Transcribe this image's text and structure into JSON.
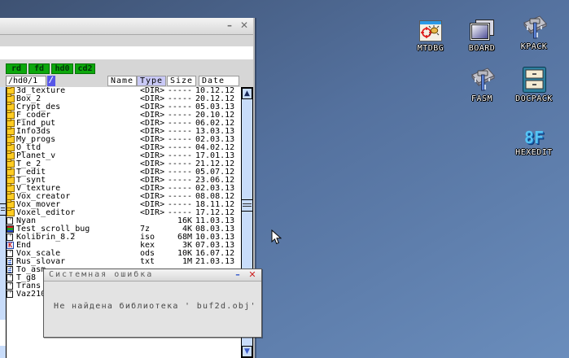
{
  "desktop": {
    "background_top": "#3e5273",
    "background_bottom": "#6a8dbc",
    "icons": [
      {
        "name": "mtdbg",
        "label": "MTDBG"
      },
      {
        "name": "board",
        "label": "BOARD"
      },
      {
        "name": "kpack",
        "label": "KPACK"
      },
      {
        "name": "fasm",
        "label": "FASM"
      },
      {
        "name": "docpack",
        "label": "DOCPACK"
      },
      {
        "name": "hexedit",
        "label": "HEXEDIT",
        "glyph": "8F"
      }
    ]
  },
  "file_manager": {
    "window_buttons": {
      "minimize": "–",
      "close": "✕"
    },
    "drive_buttons": [
      {
        "label": "rd"
      },
      {
        "label": "fd"
      },
      {
        "label": "hd0"
      },
      {
        "label": "cd2"
      }
    ],
    "path": "/hd0/1",
    "slash_button": "/",
    "columns": [
      {
        "label": "Name",
        "sorted": false
      },
      {
        "label": "Type",
        "sorted": true
      },
      {
        "label": "Size",
        "sorted": false
      },
      {
        "label": "Date",
        "sorted": false
      }
    ],
    "sort_highlight_color": "#c9c9f6",
    "drive_button_color": "#0ca80c",
    "scrollbar": {
      "up": "▲",
      "down": "▼"
    },
    "rows": [
      {
        "name": "3d_texture",
        "type": "<DIR>",
        "size": "-----",
        "date": "10.12.12",
        "icon": "folder"
      },
      {
        "name": "Box_2",
        "type": "<DIR>",
        "size": "-----",
        "date": "20.12.12",
        "icon": "folder"
      },
      {
        "name": "Crypt_des",
        "type": "<DIR>",
        "size": "-----",
        "date": "05.03.13",
        "icon": "folder"
      },
      {
        "name": "F_coder",
        "type": "<DIR>",
        "size": "-----",
        "date": "20.10.12",
        "icon": "folder"
      },
      {
        "name": "Find_put",
        "type": "<DIR>",
        "size": "-----",
        "date": "06.02.12",
        "icon": "folder"
      },
      {
        "name": "Info3ds",
        "type": "<DIR>",
        "size": "-----",
        "date": "13.03.13",
        "icon": "folder"
      },
      {
        "name": "My_progs",
        "type": "<DIR>",
        "size": "-----",
        "date": "02.03.13",
        "icon": "folder"
      },
      {
        "name": "O_ttd",
        "type": "<DIR>",
        "size": "-----",
        "date": "04.02.12",
        "icon": "folder"
      },
      {
        "name": "Planet_v",
        "type": "<DIR>",
        "size": "-----",
        "date": "17.01.13",
        "icon": "folder"
      },
      {
        "name": "T_e_2",
        "type": "<DIR>",
        "size": "-----",
        "date": "21.12.12",
        "icon": "folder"
      },
      {
        "name": "T_edit",
        "type": "<DIR>",
        "size": "-----",
        "date": "05.07.12",
        "icon": "folder"
      },
      {
        "name": "T_synt",
        "type": "<DIR>",
        "size": "-----",
        "date": "23.06.12",
        "icon": "folder"
      },
      {
        "name": "V_texture",
        "type": "<DIR>",
        "size": "-----",
        "date": "02.03.13",
        "icon": "folder"
      },
      {
        "name": "Vox_creator",
        "type": "<DIR>",
        "size": "-----",
        "date": "08.08.12",
        "icon": "folder"
      },
      {
        "name": "Vox_mover",
        "type": "<DIR>",
        "size": "-----",
        "date": "18.11.12",
        "icon": "folder"
      },
      {
        "name": "Voxel_editor",
        "type": "<DIR>",
        "size": "-----",
        "date": "17.12.12",
        "icon": "folder"
      },
      {
        "name": "Nyan",
        "type": "",
        "size": "16K",
        "date": "11.03.13",
        "icon": "file"
      },
      {
        "name": "Test_scroll_bug",
        "type": "7z",
        "size": "4K",
        "date": "08.03.13",
        "icon": "archive"
      },
      {
        "name": "Kolibrin_8.2",
        "type": "iso",
        "size": "68M",
        "date": "10.03.13",
        "icon": "file"
      },
      {
        "name": "End",
        "type": "kex",
        "size": "3K",
        "date": "07.03.13",
        "icon": "kolibri"
      },
      {
        "name": "Vox_scale",
        "type": "ods",
        "size": "10K",
        "date": "16.07.12",
        "icon": "file"
      },
      {
        "name": "Rus_slovar",
        "type": "txt",
        "size": "1M",
        "date": "21.03.13",
        "icon": "text"
      },
      {
        "name": "To_asm",
        "type": "",
        "size": "",
        "date": "",
        "icon": "text"
      },
      {
        "name": "T_g8",
        "type": "",
        "size": "",
        "date": "",
        "icon": "file"
      },
      {
        "name": "Trans",
        "type": "",
        "size": "",
        "date": "",
        "icon": "file"
      },
      {
        "name": "Vaz210",
        "type": "",
        "size": "",
        "date": "",
        "icon": "file"
      }
    ]
  },
  "error_dialog": {
    "title": "Системная ошибка",
    "message": "Не найдена библиотека ' buf2d.obj'",
    "minimize": "–",
    "close": "✕"
  }
}
